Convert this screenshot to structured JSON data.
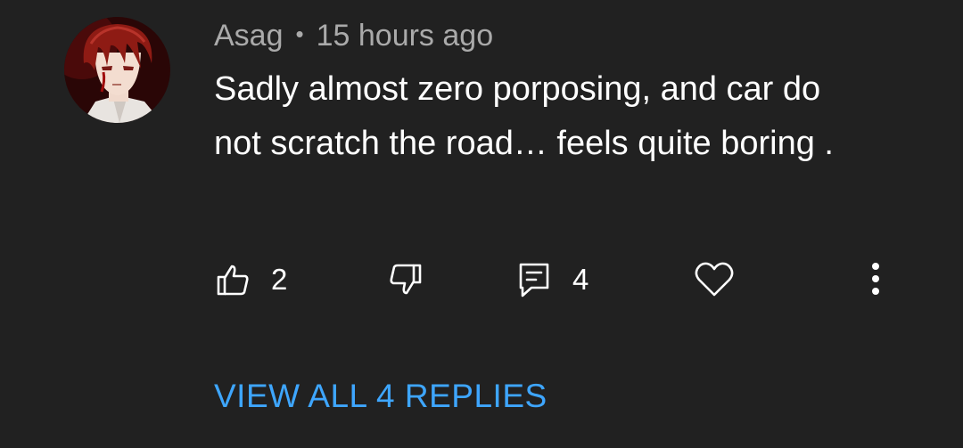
{
  "comment": {
    "author": "Asag",
    "separator": "•",
    "timestamp": "15 hours ago",
    "text": "Sadly almost zero porposing, and car do not scratch the road… feels quite boring .",
    "avatar_icon": "anime-avatar-icon"
  },
  "actions": {
    "like_icon": "thumbs-up-icon",
    "like_count": "2",
    "dislike_icon": "thumbs-down-icon",
    "reply_icon": "reply-comment-icon",
    "reply_count": "4",
    "heart_icon": "heart-icon",
    "more_icon": "more-vertical-icon"
  },
  "replies": {
    "view_all_label": "VIEW ALL 4 REPLIES"
  },
  "colors": {
    "background": "#212121",
    "link": "#3ea6ff",
    "meta_text": "#aaaaaa",
    "body_text": "#ffffff"
  }
}
